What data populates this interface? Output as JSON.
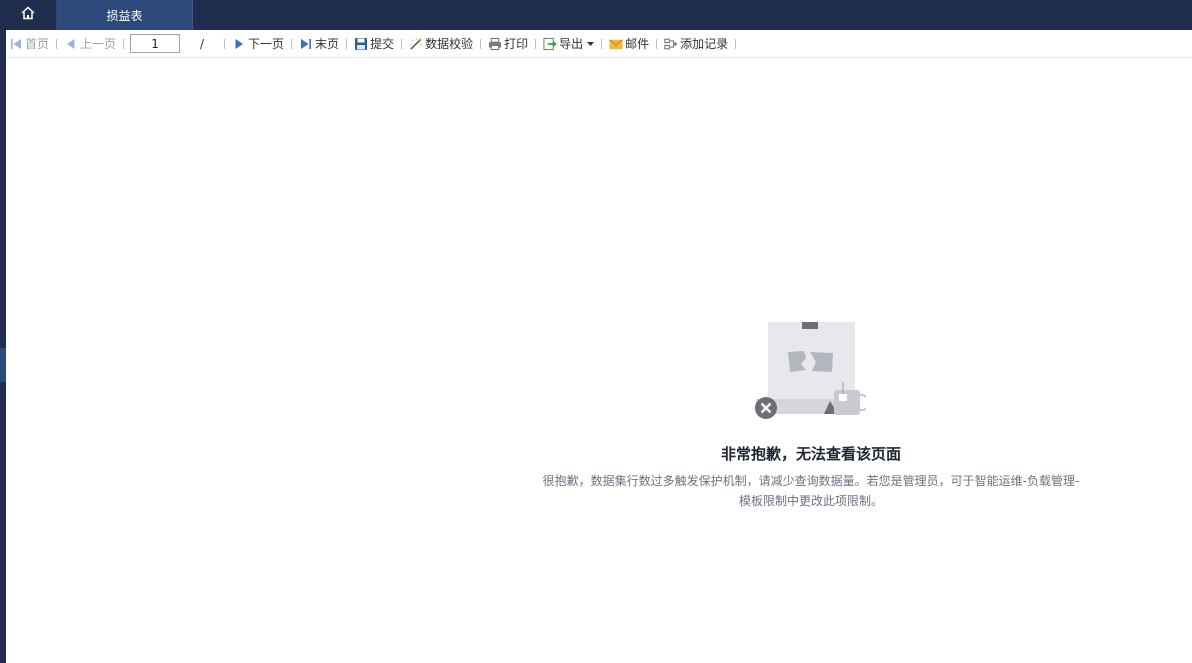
{
  "header": {
    "home_icon": "home-icon",
    "active_tab": "损益表"
  },
  "toolbar": {
    "first_label": "首页",
    "prev_label": "上一页",
    "page_value": "1",
    "page_separator": "/",
    "next_label": "下一页",
    "last_label": "末页",
    "submit_label": "提交",
    "validate_label": "数据校验",
    "print_label": "打印",
    "export_label": "导出",
    "mail_label": "邮件",
    "add_record_label": "添加记录"
  },
  "error": {
    "title": "非常抱歉，无法查看该页面",
    "desc_line1": "很抱歉，数据集行数过多触发保护机制，请减少查询数据量。若您是管理员，可于智能运维-负载管理-",
    "desc_line2": "模板限制中更改此项限制。"
  },
  "colors": {
    "topbar": "#1f2d4e",
    "active_tab": "#2c4a7c",
    "nav_blue": "#2f6fd6",
    "accent_orange": "#e8a03a"
  }
}
